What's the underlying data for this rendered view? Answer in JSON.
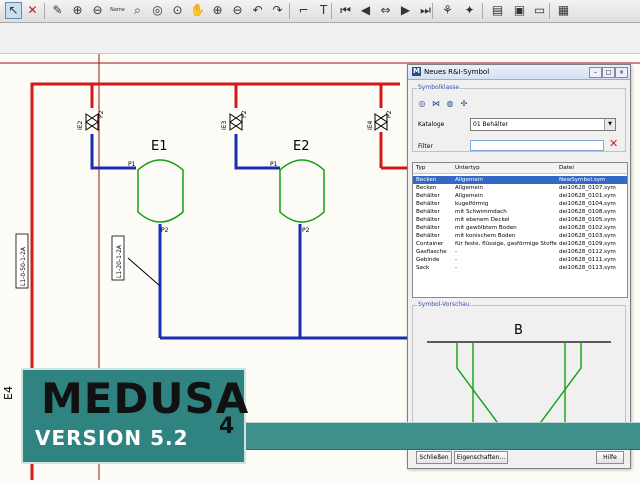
{
  "toolbar": {
    "icons": [
      "pointer-icon",
      "delete-icon",
      "edit-icon",
      "zoom-in-icon",
      "zoom-out-icon",
      "zoom-name-icon",
      "find-icon",
      "zoom-window-icon",
      "zoom-page-icon",
      "pan-hand-icon",
      "zoom-fit-icon",
      "zoom-region-icon",
      "undo-icon",
      "redo-icon",
      "corner-icon",
      "text-tool-icon",
      "first-page-icon",
      "prev-page-icon",
      "page-swap-icon",
      "next-page-icon",
      "last-page-icon",
      "symbol-pick-icon",
      "symbol-place-icon",
      "layer-icon",
      "image-icon",
      "view-icon",
      "grid-icon"
    ],
    "zoom_name_label": "Name"
  },
  "drawing": {
    "vessel_left_label": "E1",
    "vessel_right_label": "E2",
    "pin_p1": "P1",
    "pin_p2": "P2",
    "valve_left_tag": "IE2",
    "valve_mid_tag": "IE3",
    "valve_right_tag": "IE4",
    "line_tag_vertical": "L1-0-50-1-2A",
    "line_tag_diagonal": "L1-20-1-2A",
    "side_tag": "E4",
    "colors": {
      "red_line": "#d31818",
      "blue_line": "#1a2fb0",
      "symbol": "#10a010",
      "border": "#a01010"
    }
  },
  "dialog": {
    "title": "Neues R&I-Symbol",
    "group_class_label": "Symbolklasse",
    "katalog_label": "Kataloge",
    "katalog_value": "01 Behälter",
    "filter_label": "Filter",
    "filter_value": "",
    "columns": [
      "Typ",
      "Untertyp",
      "Datei"
    ],
    "rows": [
      {
        "typ": "Becken",
        "untertyp": "Allgemein",
        "datei": "NewSymbol.sym",
        "selected": true
      },
      {
        "typ": "Becken",
        "untertyp": "Allgemein",
        "datei": "dei10628_0107.sym"
      },
      {
        "typ": "Behälter",
        "untertyp": "Allgemein",
        "datei": "dei10628_0101.sym"
      },
      {
        "typ": "Behälter",
        "untertyp": "kugelförmig",
        "datei": "dei10628_0104.sym"
      },
      {
        "typ": "Behälter",
        "untertyp": "mit Schwimmdach",
        "datei": "dei10628_0108.sym"
      },
      {
        "typ": "Behälter",
        "untertyp": "mit ebenem Deckel",
        "datei": "dei10628_0105.sym"
      },
      {
        "typ": "Behälter",
        "untertyp": "mit gewölbtem Boden",
        "datei": "dei10628_0102.sym"
      },
      {
        "typ": "Behälter",
        "untertyp": "mit konischem Boden",
        "datei": "dei10628_0103.sym"
      },
      {
        "typ": "Container",
        "untertyp": "für feste, flüssige, gasförmige Stoffe",
        "datei": "dei10628_0109.sym"
      },
      {
        "typ": "Gasflasche",
        "untertyp": "-",
        "datei": "dei10628_0112.sym"
      },
      {
        "typ": "Gebinde",
        "untertyp": "-",
        "datei": "dei10628_0111.sym"
      },
      {
        "typ": "Sack",
        "untertyp": "-",
        "datei": "dei10628_0113.sym"
      }
    ],
    "preview_label": "Symbol-Vorschau",
    "preview_letter": "B",
    "btn_close": "Schließen",
    "btn_props": "Eigenschaften...",
    "btn_help": "Hilfe"
  },
  "brand": {
    "word": "MEDUSA",
    "number": "4",
    "version": "VERSION 5.2",
    "banner_color": "#3f8f8c"
  }
}
